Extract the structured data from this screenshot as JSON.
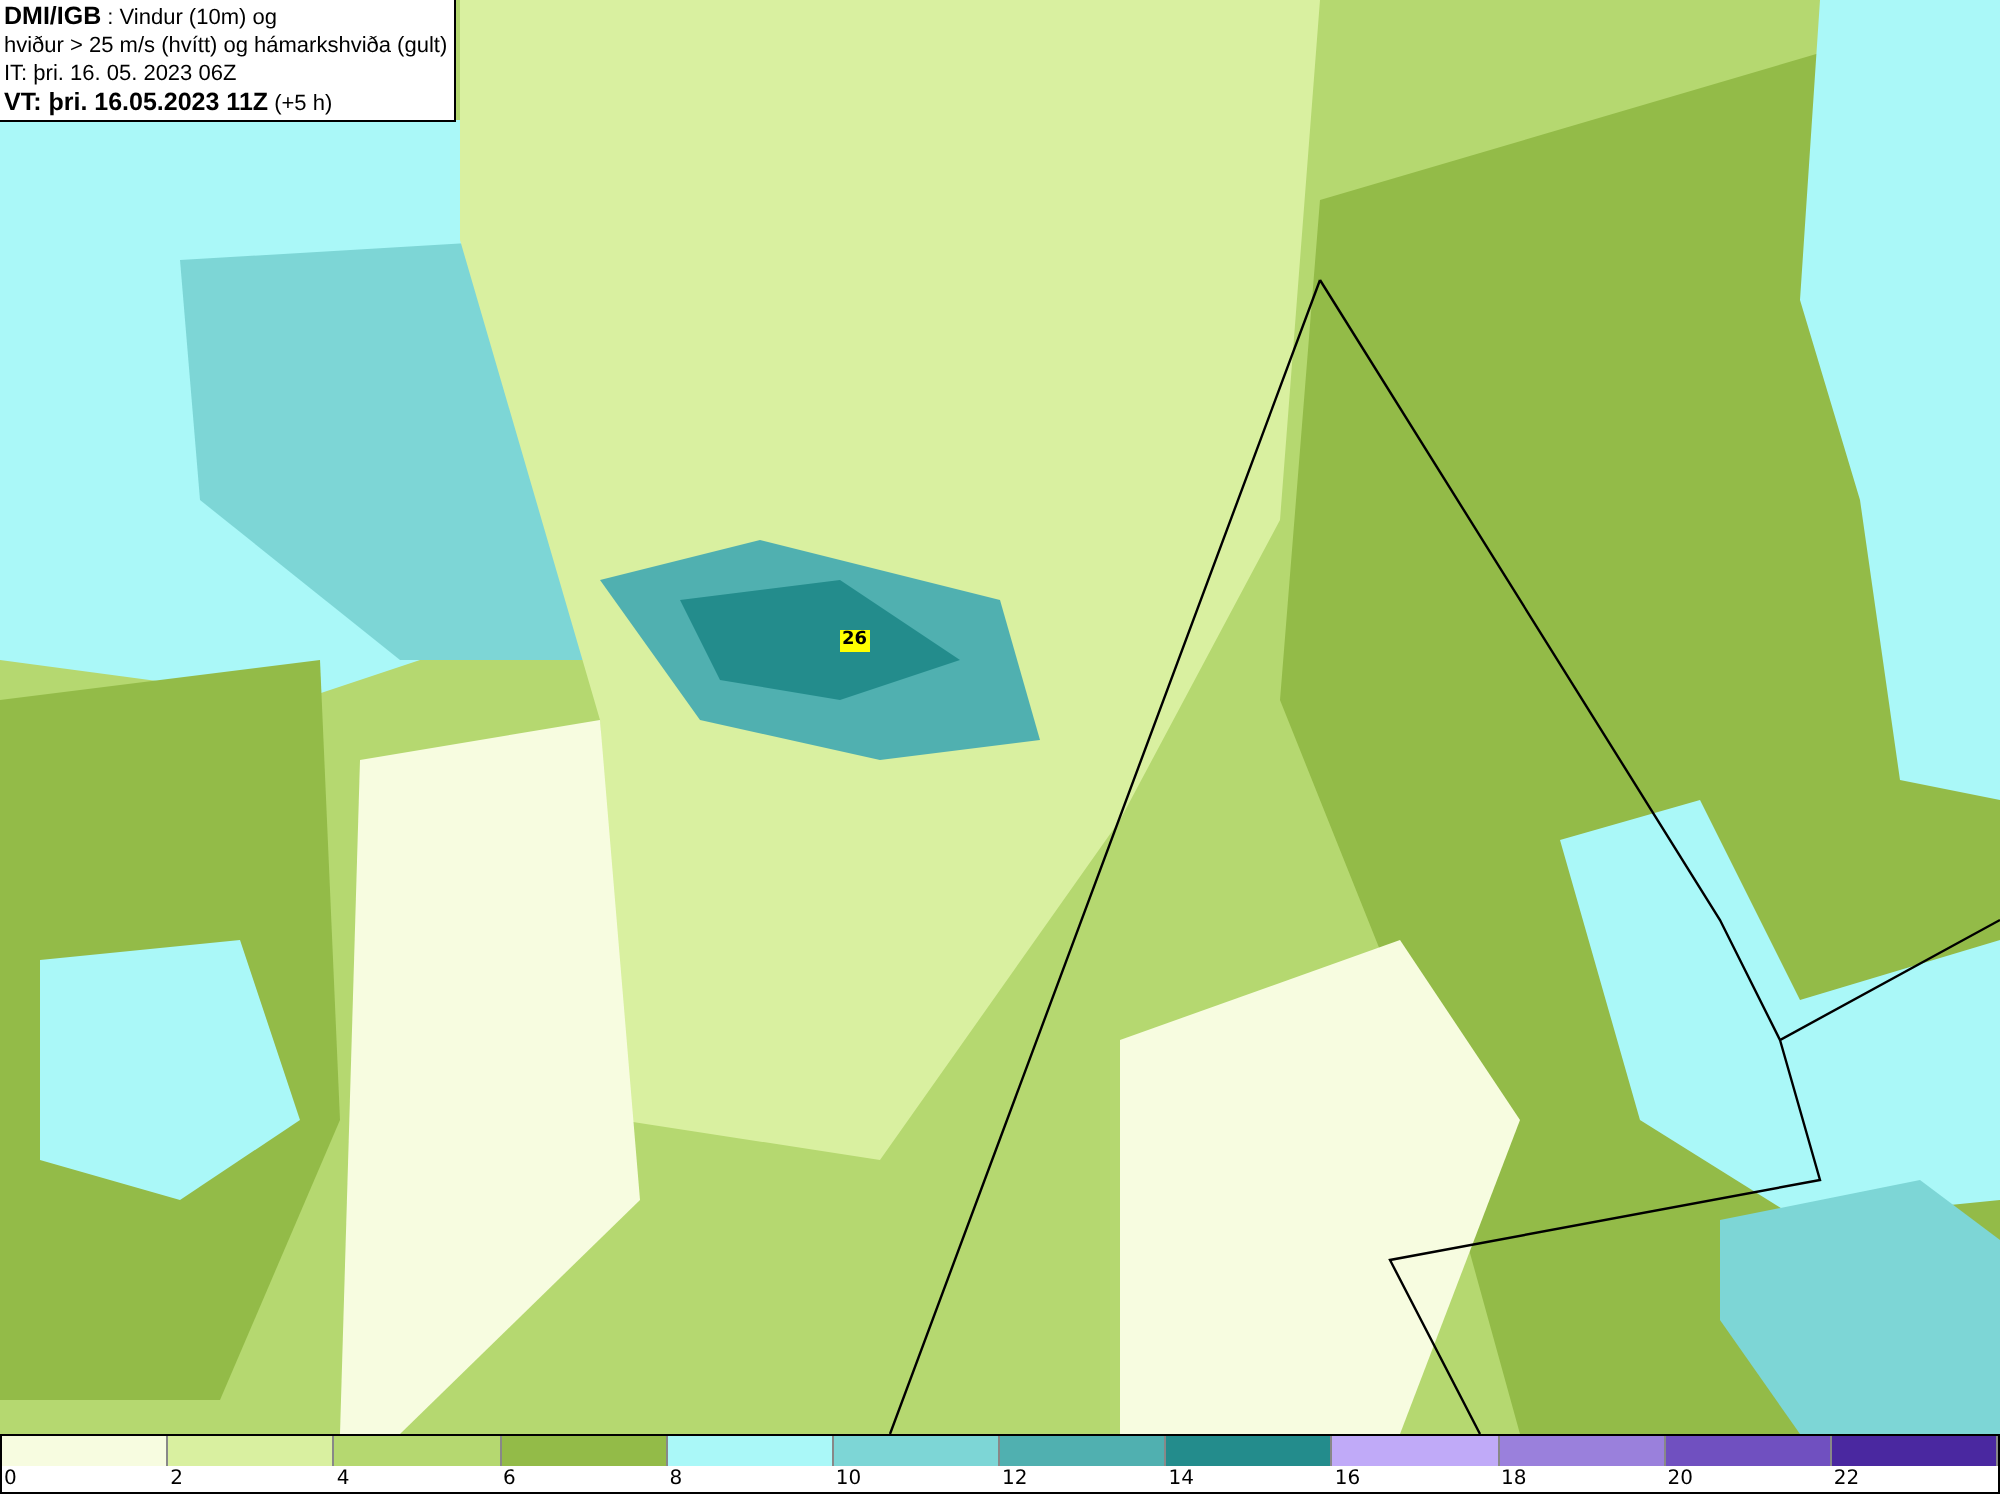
{
  "header": {
    "title": "DMI/IGB",
    "subtitle_first": " : Vindur (10m) og",
    "subtitle_second": "hviður > 25 m/s (hvítt) og hámarkshviða (gult)",
    "issue_time": "IT: þri. 16. 05. 2023 06Z",
    "valid_time": "VT: þri. 16.05.2023 11Z",
    "valid_offset": " (+5 h)"
  },
  "map": {
    "max_gust_label": "26"
  },
  "legend": [
    {
      "label": "0",
      "color": "#f7fce0"
    },
    {
      "label": "2",
      "color": "#d9f0a0"
    },
    {
      "label": "4",
      "color": "#b5d870"
    },
    {
      "label": "6",
      "color": "#93bb48"
    },
    {
      "label": "8",
      "color": "#aaf8f8"
    },
    {
      "label": "10",
      "color": "#7dd6d6"
    },
    {
      "label": "12",
      "color": "#50b0b0"
    },
    {
      "label": "14",
      "color": "#238c8c"
    },
    {
      "label": "16",
      "color": "#c0aaf8"
    },
    {
      "label": "18",
      "color": "#9a80dc"
    },
    {
      "label": "20",
      "color": "#7050c0"
    },
    {
      "label": "22",
      "color": "#4a28a0"
    }
  ]
}
